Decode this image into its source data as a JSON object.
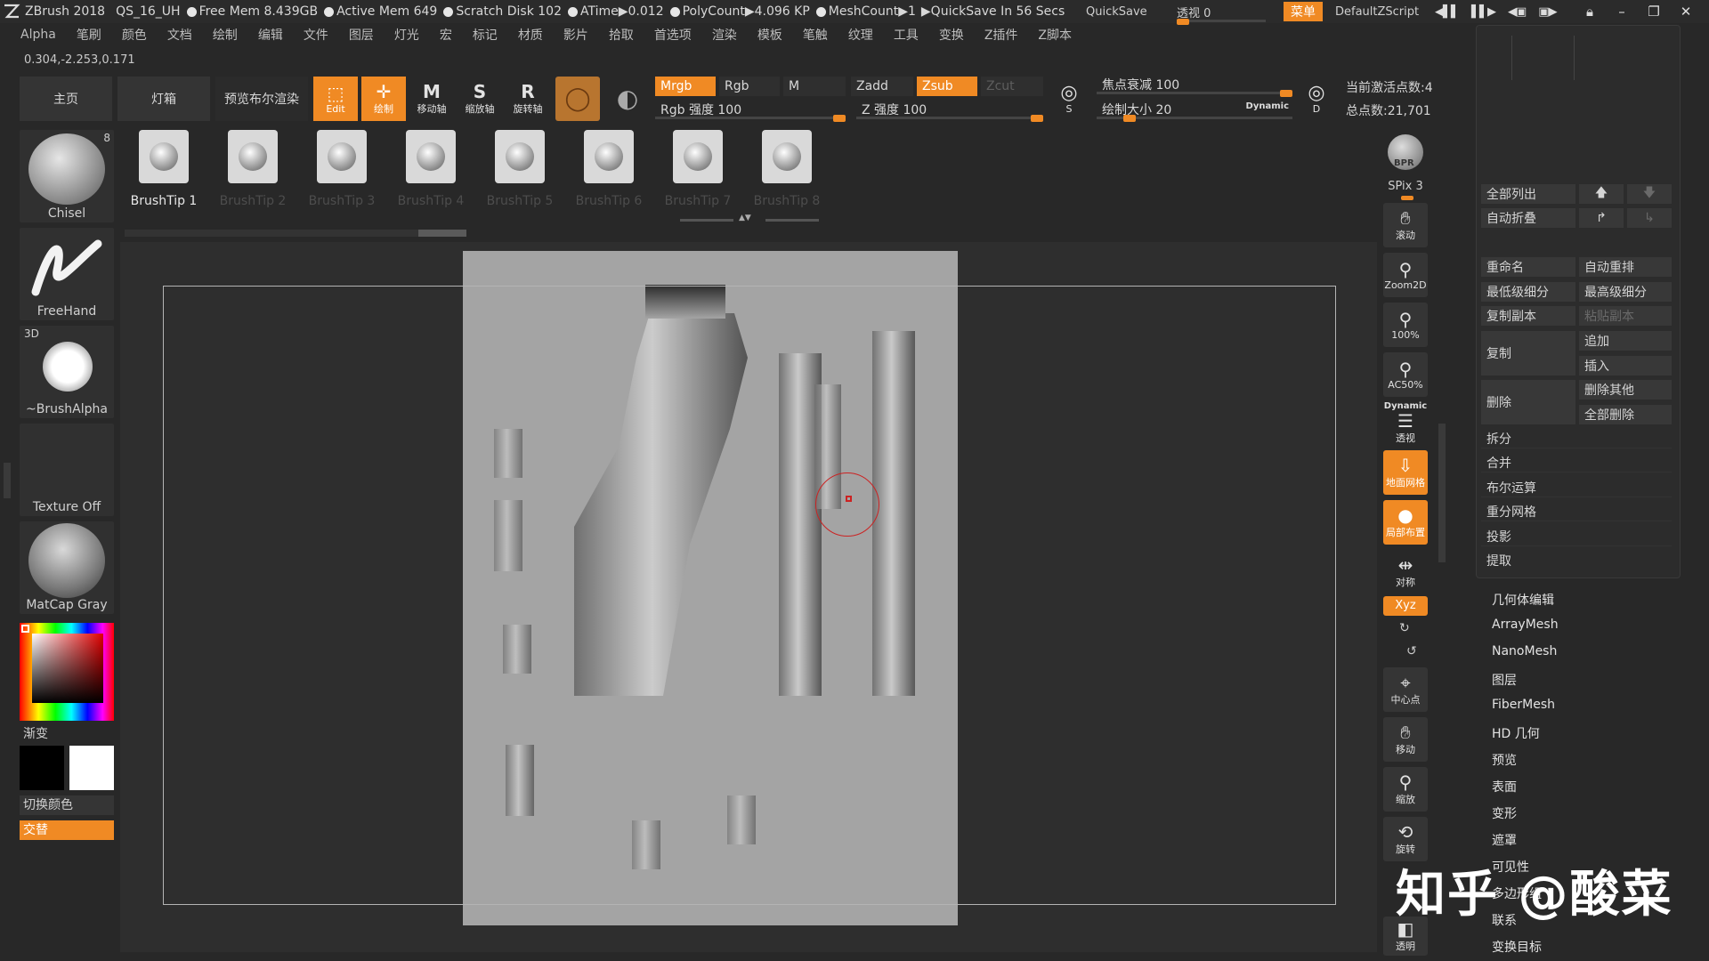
{
  "titlebar": {
    "app": "ZBrush 2018",
    "doc": "QS_16_UH",
    "stats": [
      "Free Mem 8.439GB",
      "Active Mem 649",
      "Scratch Disk 102",
      "ATime▶0.012",
      "PolyCount▶4.096 KP",
      "MeshCount▶1"
    ],
    "quicksave_info": "▶QuickSave In 56 Secs",
    "quicksave": "QuickSave",
    "transparency": "透视  0",
    "menu": "菜单",
    "script": "DefaultZScript"
  },
  "menubar": [
    "Alpha",
    "笔刷",
    "颜色",
    "文档",
    "绘制",
    "编辑",
    "文件",
    "图层",
    "灯光",
    "宏",
    "标记",
    "材质",
    "影片",
    "拾取",
    "首选项",
    "渲染",
    "模板",
    "笔触",
    "纹理",
    "工具",
    "变换",
    "Z插件",
    "Z脚本"
  ],
  "coords": "0.304,-2.253,0.171",
  "toolbar": {
    "home": "主页",
    "lightbox": "灯箱",
    "bpr_preview": "预览布尔渲染",
    "edit": "Edit",
    "draw": "绘制",
    "move": "移动轴",
    "scale": "缩放轴",
    "rotate": "旋转轴",
    "mrgb": "Mrgb",
    "rgb": "Rgb",
    "m": "M",
    "rgb_intensity": "Rgb 强度 100",
    "zadd": "Zadd",
    "zsub": "Zsub",
    "zcut": "Zcut",
    "z_intensity": "Z 强度 100",
    "focal_shift": "焦点衰减 100",
    "draw_size": "绘制大小 20",
    "dynamic": "Dynamic",
    "active_points": "当前激活点数:4",
    "total_points": "总点数:21,701",
    "s_label": "S",
    "d_label": "D"
  },
  "left_shelf": {
    "brush": "Chisel",
    "brush_count": "8",
    "stroke": "FreeHand",
    "alpha_tag": "3D",
    "alpha": "~BrushAlpha",
    "texture": "Texture Off",
    "material": "MatCap Gray",
    "gradient": "渐变",
    "switch_color": "切换颜色",
    "alternate": "交替"
  },
  "brush_tips": [
    "BrushTip 1",
    "BrushTip 2",
    "BrushTip 3",
    "BrushTip 4",
    "BrushTip 5",
    "BrushTip 6",
    "BrushTip 7",
    "BrushTip 8"
  ],
  "right_toolbar": {
    "bpr": "BPR",
    "spix": "SPix 3",
    "scroll": "滚动",
    "zoom2d": "Zoom2D",
    "actual": "100%",
    "ac50": "AC50%",
    "dynamic": "Dynamic",
    "persp": "透视",
    "floor": "地面网格",
    "local": "局部布置",
    "sym": "对称",
    "xyz": "Xyz",
    "frame": "中心点",
    "move": "移动",
    "scale": "缩放",
    "rotate": "旋转",
    "transp": "透明"
  },
  "subtool_panel": {
    "list_all": "全部列出",
    "auto_collapse": "自动折叠",
    "rename": "重命名",
    "auto_reorder": "自动重排",
    "all_low": "最低级细分",
    "all_high": "最高级细分",
    "copy": "复制副本",
    "paste": "粘贴副本",
    "duplicate": "复制",
    "append": "追加",
    "insert": "插入",
    "delete": "删除",
    "del_other": "删除其他",
    "del_all": "全部删除",
    "split": "拆分",
    "merge": "合并",
    "boolean": "布尔运算",
    "remesh": "重分网格",
    "project": "投影",
    "extract": "提取"
  },
  "tool_sections": [
    "几何体编辑",
    "ArrayMesh",
    "NanoMesh",
    "图层",
    "FiberMesh",
    "HD 几何",
    "预览",
    "表面",
    "变形",
    "遮罩",
    "可见性",
    "多边形组",
    "联系",
    "变换目标"
  ],
  "watermark": "知乎 @酸菜",
  "colors": {
    "accent": "#f08a24",
    "panel": "#2c2c2c",
    "bg": "#282828"
  }
}
